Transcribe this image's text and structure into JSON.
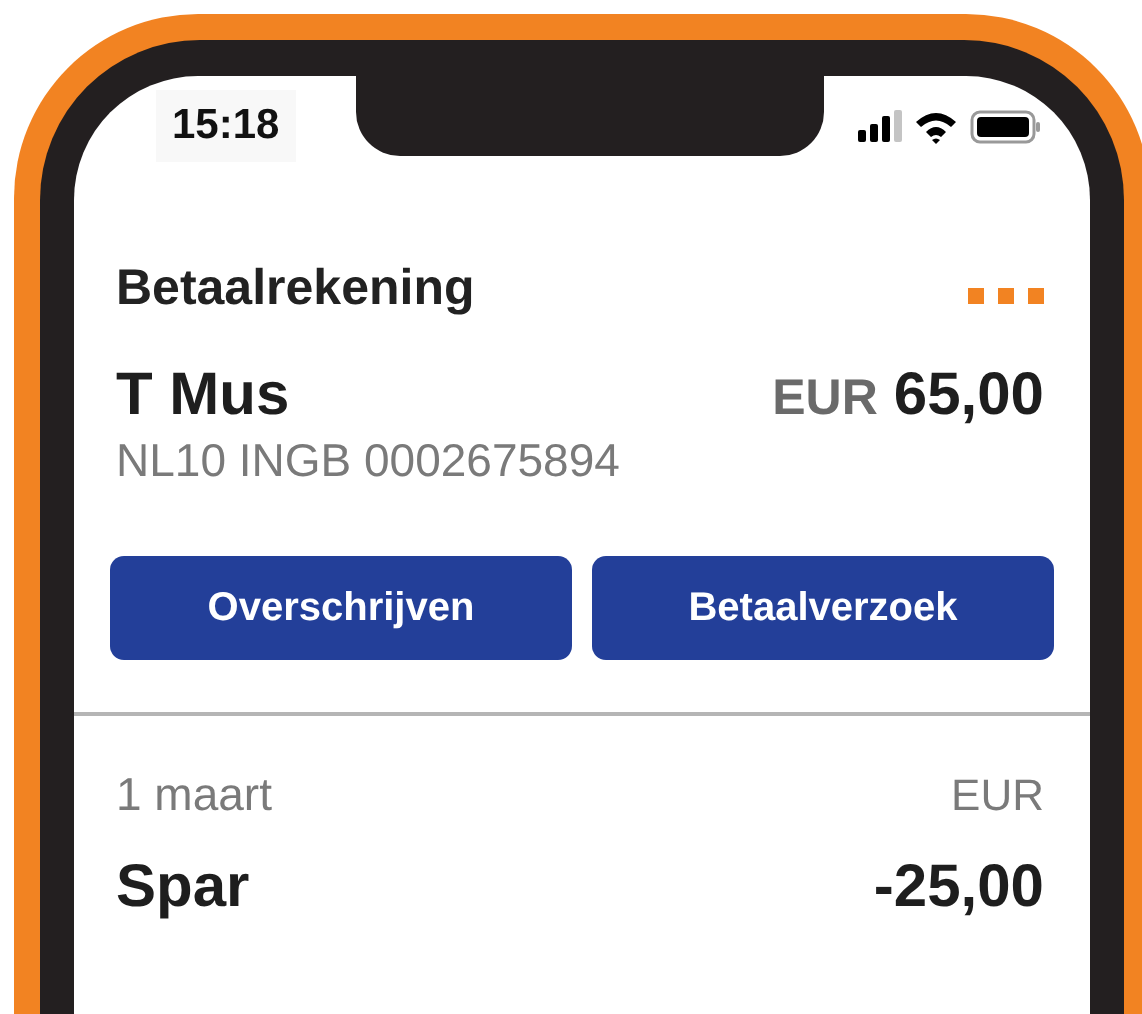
{
  "status_bar": {
    "time": "15:18"
  },
  "account": {
    "title": "Betaalrekening",
    "holder": "T Mus",
    "currency": "EUR",
    "balance": "65,00",
    "iban": "NL10 INGB 0002675894"
  },
  "actions": [
    {
      "label": "Overschrijven"
    },
    {
      "label": "Betaalverzoek"
    }
  ],
  "transactions": [
    {
      "date": "1 maart",
      "currency": "EUR",
      "description": "Spar",
      "amount": "-25,00"
    }
  ]
}
